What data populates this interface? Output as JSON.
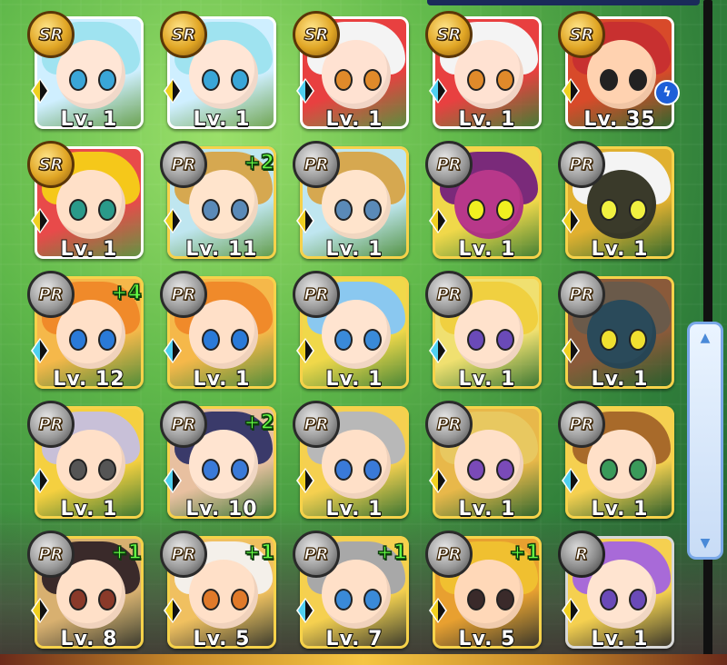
{
  "cards": [
    {
      "rarity": "SR",
      "level": "Lv. 1",
      "plus": "",
      "element_color": "#f0d020",
      "hair": "#9fe3f0",
      "skin": "#ffe6d6",
      "eye": "#3aa6d8",
      "bg": "#cfefff",
      "frame": "sr"
    },
    {
      "rarity": "SR",
      "level": "Lv. 1",
      "plus": "",
      "element_color": "#f0d020",
      "hair": "#9fe3f0",
      "skin": "#ffe6d6",
      "eye": "#3aa6d8",
      "bg": "#cfefff",
      "frame": "sr"
    },
    {
      "rarity": "SR",
      "level": "Lv. 1",
      "plus": "",
      "element_color": "#4fd0f0",
      "hair": "#f4f4f4",
      "skin": "#ffe2d2",
      "eye": "#e08a2a",
      "bg": "#e84040",
      "frame": "sr"
    },
    {
      "rarity": "SR",
      "level": "Lv. 1",
      "plus": "",
      "element_color": "#4fd0f0",
      "hair": "#f4f4f4",
      "skin": "#ffe2d2",
      "eye": "#e08a2a",
      "bg": "#e84040",
      "frame": "sr"
    },
    {
      "rarity": "SR",
      "level": "Lv. 35",
      "plus": "",
      "element_color": "#f0d020",
      "hair": "#c83030",
      "skin": "#ffd2b0",
      "eye": "#222",
      "bg": "#d84a2a",
      "frame": "sr",
      "bolt": true
    },
    {
      "rarity": "SR",
      "level": "Lv. 1",
      "plus": "",
      "element_color": "#f0d020",
      "hair": "#f5c81a",
      "skin": "#ffe0c8",
      "eye": "#2a9a8a",
      "bg": "#e84a4a",
      "frame": "sr"
    },
    {
      "rarity": "PR",
      "level": "Lv. 11",
      "plus": "+2",
      "element_color": "#f0d020",
      "hair": "#d6a850",
      "skin": "#ffe4cc",
      "eye": "#5a8ab8",
      "bg": "#bfe6f0",
      "frame": "pr"
    },
    {
      "rarity": "PR",
      "level": "Lv. 1",
      "plus": "",
      "element_color": "#f0d020",
      "hair": "#d6a850",
      "skin": "#ffe4cc",
      "eye": "#5a8ab8",
      "bg": "#bfe6f0",
      "frame": "pr"
    },
    {
      "rarity": "PR",
      "level": "Lv. 1",
      "plus": "",
      "element_color": "#f0d020",
      "hair": "#7a2a7a",
      "skin": "#b8388a",
      "eye": "#f0f020",
      "bg": "#f0d84a",
      "frame": "pr"
    },
    {
      "rarity": "PR",
      "level": "Lv. 1",
      "plus": "",
      "element_color": "#f0d020",
      "hair": "#f4f4f4",
      "skin": "#3a3a2a",
      "eye": "#f0f040",
      "bg": "#e0b030",
      "frame": "pr"
    },
    {
      "rarity": "PR",
      "level": "Lv. 12",
      "plus": "+4",
      "element_color": "#4fd0f0",
      "hair": "#f08a2a",
      "skin": "#ffe0c8",
      "eye": "#2a7ad8",
      "bg": "#f5b84a",
      "frame": "pr"
    },
    {
      "rarity": "PR",
      "level": "Lv. 1",
      "plus": "",
      "element_color": "#4fd0f0",
      "hair": "#f08a2a",
      "skin": "#ffe0c8",
      "eye": "#2a7ad8",
      "bg": "#f5b84a",
      "frame": "pr"
    },
    {
      "rarity": "PR",
      "level": "Lv. 1",
      "plus": "",
      "element_color": "#f0d020",
      "hair": "#8ac8f0",
      "skin": "#ffe4d0",
      "eye": "#3a8ad8",
      "bg": "#f0d84a",
      "frame": "pr"
    },
    {
      "rarity": "PR",
      "level": "Lv. 1",
      "plus": "",
      "element_color": "#4fd0f0",
      "hair": "#f0d040",
      "skin": "#ffe2cc",
      "eye": "#6a4ab8",
      "bg": "#f0e070",
      "frame": "pr"
    },
    {
      "rarity": "PR",
      "level": "Lv. 1",
      "plus": "",
      "element_color": "#f0d020",
      "hair": "#6a5a4a",
      "skin": "#2a4a5a",
      "eye": "#f0e030",
      "bg": "#8a5a3a",
      "frame": "pr"
    },
    {
      "rarity": "PR",
      "level": "Lv. 1",
      "plus": "",
      "element_color": "#4fd0f0",
      "hair": "#c8c0d8",
      "skin": "#ffe0c8",
      "eye": "#555",
      "bg": "#f5d040",
      "frame": "pr"
    },
    {
      "rarity": "PR",
      "level": "Lv. 10",
      "plus": "+2",
      "element_color": "#4fd0f0",
      "hair": "#3a3a6a",
      "skin": "#ffe4d0",
      "eye": "#3a7ad8",
      "bg": "#e8c0a0",
      "frame": "pr"
    },
    {
      "rarity": "PR",
      "level": "Lv. 1",
      "plus": "",
      "element_color": "#f0d020",
      "hair": "#b8b8b8",
      "skin": "#ffe0c8",
      "eye": "#3a7ad8",
      "bg": "#f5d050",
      "frame": "pr"
    },
    {
      "rarity": "PR",
      "level": "Lv. 1",
      "plus": "",
      "element_color": "#f0d020",
      "hair": "#e8c860",
      "skin": "#ffe0c8",
      "eye": "#7a4ab8",
      "bg": "#e8b84a",
      "frame": "pr"
    },
    {
      "rarity": "PR",
      "level": "Lv. 1",
      "plus": "",
      "element_color": "#4fd0f0",
      "hair": "#a86a2a",
      "skin": "#ffe0c8",
      "eye": "#3a9a5a",
      "bg": "#f5d050",
      "frame": "pr"
    },
    {
      "rarity": "PR",
      "level": "Lv. 8",
      "plus": "+1",
      "element_color": "#f0d020",
      "hair": "#3a2a2a",
      "skin": "#ffe0c8",
      "eye": "#8a3a2a",
      "bg": "#d8b070",
      "frame": "pr"
    },
    {
      "rarity": "PR",
      "level": "Lv. 5",
      "plus": "+1",
      "element_color": "#f0d020",
      "hair": "#f4f0ea",
      "skin": "#ffe0c8",
      "eye": "#e07a2a",
      "bg": "#f0c060",
      "frame": "pr"
    },
    {
      "rarity": "PR",
      "level": "Lv. 7",
      "plus": "+1",
      "element_color": "#4fd0f0",
      "hair": "#a8a8a8",
      "skin": "#ffe0c8",
      "eye": "#3a8ad8",
      "bg": "#f5d050",
      "frame": "pr"
    },
    {
      "rarity": "PR",
      "level": "Lv. 5",
      "plus": "+1",
      "element_color": "#f0d020",
      "hair": "#f0c030",
      "skin": "#ffd8b8",
      "eye": "#3a2a2a",
      "bg": "#e8a030",
      "frame": "pr"
    },
    {
      "rarity": "R",
      "level": "Lv. 1",
      "plus": "",
      "element_color": "#f0d020",
      "hair": "#a86ad8",
      "skin": "#ffe4d0",
      "eye": "#6a4ab8",
      "bg": "#f5d050",
      "frame": "r"
    }
  ],
  "scrollbar": {
    "up_icon": "chevron-up-icon",
    "down_icon": "chevron-down-icon"
  }
}
